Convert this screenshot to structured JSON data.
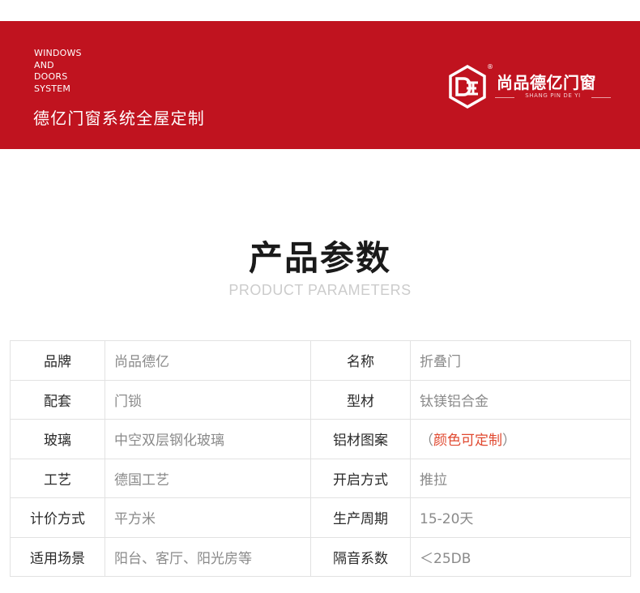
{
  "banner": {
    "tagline_lines": [
      "WINDOWS",
      "AND",
      "DOORS",
      "SYSTEM"
    ],
    "slogan": "德亿门窗系统全屋定制",
    "background_color": "#c0131f"
  },
  "brand": {
    "name": "尚品德亿门窗",
    "registered_mark": "®",
    "pinyin": "SHANG PIN DE YI",
    "logo_icon": "hexagon-de-logo"
  },
  "section": {
    "title": "产品参数",
    "subtitle": "PRODUCT PARAMETERS"
  },
  "params": {
    "rows": [
      {
        "k1": "品牌",
        "v1": "尚品德亿",
        "k2": "名称",
        "v2": "折叠门"
      },
      {
        "k1": "配套",
        "v1": "门锁",
        "k2": "型材",
        "v2": "钛镁铝合金"
      },
      {
        "k1": "玻璃",
        "v1": "中空双层钢化玻璃",
        "k2": "铝材图案",
        "v2_open": "（",
        "v2": "颜色可定制",
        "v2_close": "）"
      },
      {
        "k1": "工艺",
        "v1": "德国工艺",
        "k2": "开启方式",
        "v2": "推拉"
      },
      {
        "k1": "计价方式",
        "v1": "平方米",
        "k2": "生产周期",
        "v2": "15-20天"
      },
      {
        "k1": "适用场景",
        "v1": "阳台、客厅、阳光房等",
        "k2": "隔音系数",
        "v2": "＜25DB"
      }
    ],
    "highlight_color": "#e0482f"
  }
}
